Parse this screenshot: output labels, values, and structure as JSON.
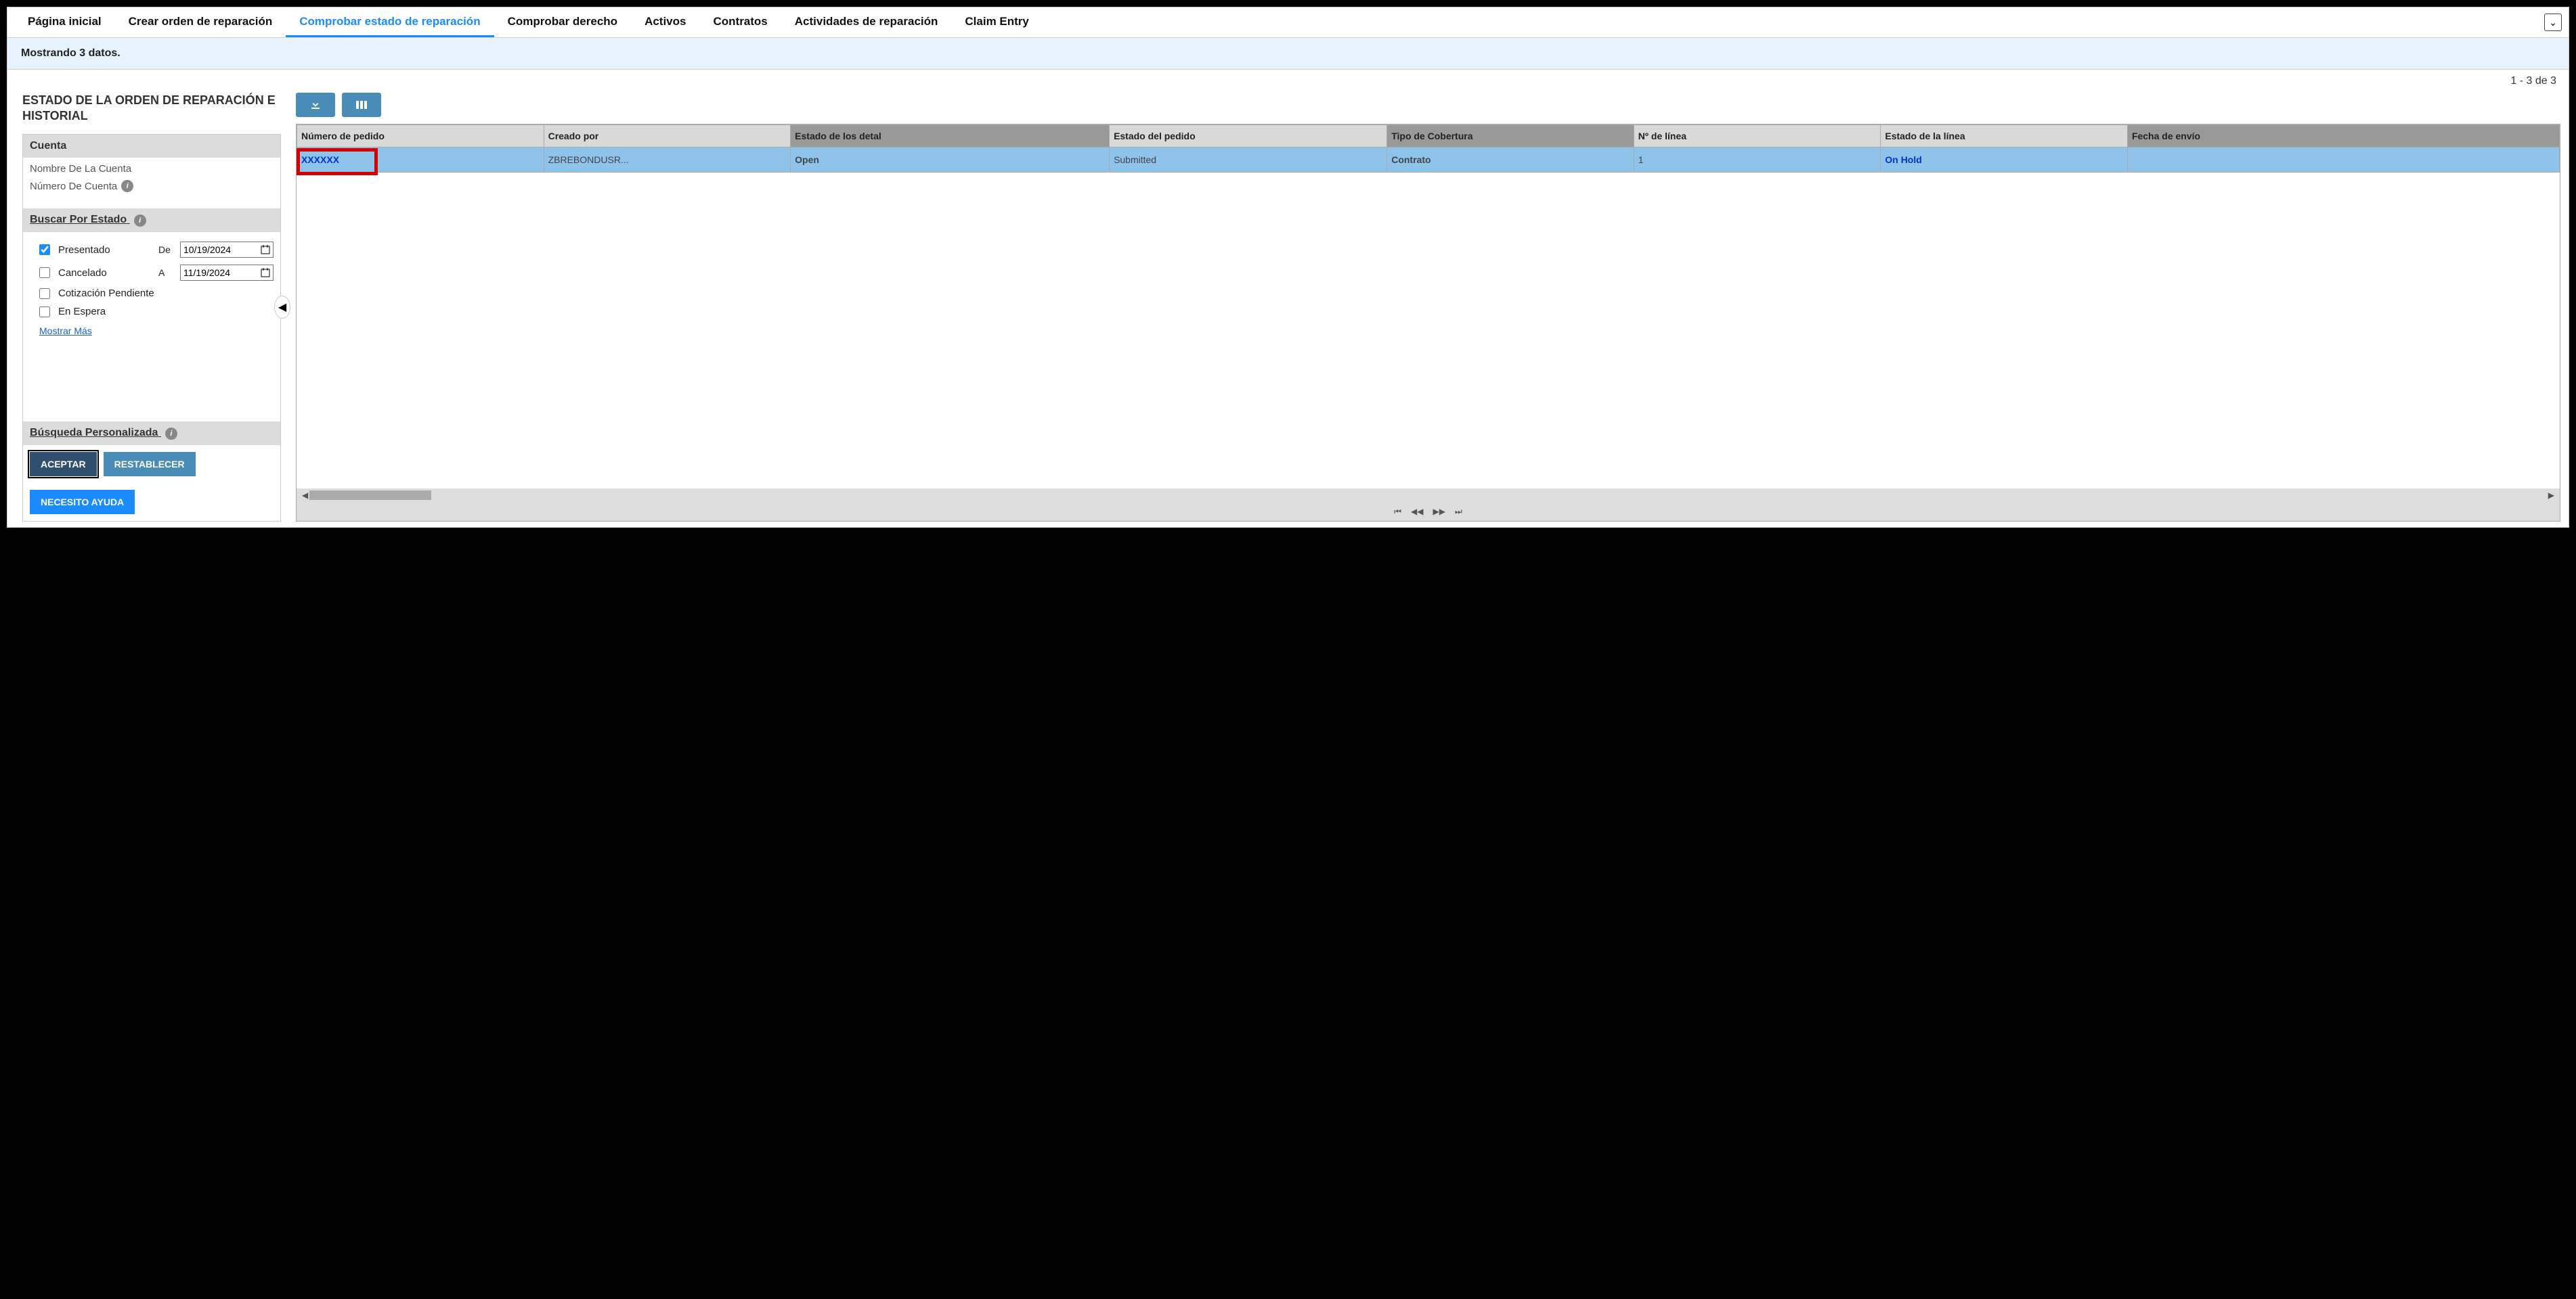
{
  "tabs": {
    "t0": "Página inicial",
    "t1": "Crear orden de reparación",
    "t2": "Comprobar estado de reparación",
    "t3": "Comprobar derecho",
    "t4": "Activos",
    "t5": "Contratos",
    "t6": "Actividades de reparación",
    "t7": "Claim Entry"
  },
  "status": "Mostrando 3 datos.",
  "pageinfo": "1 - 3 de 3",
  "sidebar": {
    "title": "ESTADO DE LA ORDEN DE REPARACIÓN E HISTORIAL",
    "account_head": "Cuenta",
    "account_name_label": "Nombre De La Cuenta",
    "account_num_label": "Número De Cuenta",
    "search_head": "Buscar Por Estado",
    "chk_submitted": "Presentado",
    "chk_cancelled": "Cancelado",
    "chk_quote_pending": "Cotización Pendiente",
    "chk_on_hold": "En Espera",
    "date_from_label": "De",
    "date_to_label": "A",
    "date_from": "10/19/2024",
    "date_to": "11/19/2024",
    "show_more": "Mostrar Más",
    "custom_search_head": "Búsqueda Personalizada",
    "btn_accept": "ACEPTAR",
    "btn_reset": "RESTABLECER",
    "btn_help": "NECESITO AYUDA"
  },
  "grid": {
    "headers": {
      "h0": "Número de pedido",
      "h1": "Creado por",
      "h2": "Estado de los detal",
      "h3": "Estado del pedido",
      "h4": "Tipo de Cobertura",
      "h5": "Nº de línea",
      "h6": "Estado de la línea",
      "h7": "Fecha de envío"
    },
    "row0": {
      "order_no": "XXXXXX",
      "created_by": "ZBREBONDUSR...",
      "detail_status": "Open",
      "order_status": "Submitted",
      "coverage": "Contrato",
      "line_no": "1",
      "line_status": "On Hold",
      "ship_date": ""
    }
  }
}
